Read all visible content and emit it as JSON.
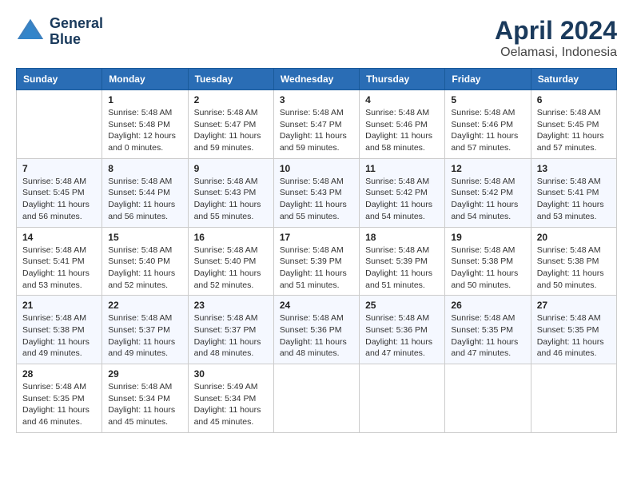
{
  "header": {
    "logo_line1": "General",
    "logo_line2": "Blue",
    "month_year": "April 2024",
    "location": "Oelamasi, Indonesia"
  },
  "weekdays": [
    "Sunday",
    "Monday",
    "Tuesday",
    "Wednesday",
    "Thursday",
    "Friday",
    "Saturday"
  ],
  "weeks": [
    [
      {
        "day": "",
        "sunrise": "",
        "sunset": "",
        "daylight": ""
      },
      {
        "day": "1",
        "sunrise": "Sunrise: 5:48 AM",
        "sunset": "Sunset: 5:48 PM",
        "daylight": "Daylight: 12 hours and 0 minutes."
      },
      {
        "day": "2",
        "sunrise": "Sunrise: 5:48 AM",
        "sunset": "Sunset: 5:47 PM",
        "daylight": "Daylight: 11 hours and 59 minutes."
      },
      {
        "day": "3",
        "sunrise": "Sunrise: 5:48 AM",
        "sunset": "Sunset: 5:47 PM",
        "daylight": "Daylight: 11 hours and 59 minutes."
      },
      {
        "day": "4",
        "sunrise": "Sunrise: 5:48 AM",
        "sunset": "Sunset: 5:46 PM",
        "daylight": "Daylight: 11 hours and 58 minutes."
      },
      {
        "day": "5",
        "sunrise": "Sunrise: 5:48 AM",
        "sunset": "Sunset: 5:46 PM",
        "daylight": "Daylight: 11 hours and 57 minutes."
      },
      {
        "day": "6",
        "sunrise": "Sunrise: 5:48 AM",
        "sunset": "Sunset: 5:45 PM",
        "daylight": "Daylight: 11 hours and 57 minutes."
      }
    ],
    [
      {
        "day": "7",
        "sunrise": "Sunrise: 5:48 AM",
        "sunset": "Sunset: 5:45 PM",
        "daylight": "Daylight: 11 hours and 56 minutes."
      },
      {
        "day": "8",
        "sunrise": "Sunrise: 5:48 AM",
        "sunset": "Sunset: 5:44 PM",
        "daylight": "Daylight: 11 hours and 56 minutes."
      },
      {
        "day": "9",
        "sunrise": "Sunrise: 5:48 AM",
        "sunset": "Sunset: 5:43 PM",
        "daylight": "Daylight: 11 hours and 55 minutes."
      },
      {
        "day": "10",
        "sunrise": "Sunrise: 5:48 AM",
        "sunset": "Sunset: 5:43 PM",
        "daylight": "Daylight: 11 hours and 55 minutes."
      },
      {
        "day": "11",
        "sunrise": "Sunrise: 5:48 AM",
        "sunset": "Sunset: 5:42 PM",
        "daylight": "Daylight: 11 hours and 54 minutes."
      },
      {
        "day": "12",
        "sunrise": "Sunrise: 5:48 AM",
        "sunset": "Sunset: 5:42 PM",
        "daylight": "Daylight: 11 hours and 54 minutes."
      },
      {
        "day": "13",
        "sunrise": "Sunrise: 5:48 AM",
        "sunset": "Sunset: 5:41 PM",
        "daylight": "Daylight: 11 hours and 53 minutes."
      }
    ],
    [
      {
        "day": "14",
        "sunrise": "Sunrise: 5:48 AM",
        "sunset": "Sunset: 5:41 PM",
        "daylight": "Daylight: 11 hours and 53 minutes."
      },
      {
        "day": "15",
        "sunrise": "Sunrise: 5:48 AM",
        "sunset": "Sunset: 5:40 PM",
        "daylight": "Daylight: 11 hours and 52 minutes."
      },
      {
        "day": "16",
        "sunrise": "Sunrise: 5:48 AM",
        "sunset": "Sunset: 5:40 PM",
        "daylight": "Daylight: 11 hours and 52 minutes."
      },
      {
        "day": "17",
        "sunrise": "Sunrise: 5:48 AM",
        "sunset": "Sunset: 5:39 PM",
        "daylight": "Daylight: 11 hours and 51 minutes."
      },
      {
        "day": "18",
        "sunrise": "Sunrise: 5:48 AM",
        "sunset": "Sunset: 5:39 PM",
        "daylight": "Daylight: 11 hours and 51 minutes."
      },
      {
        "day": "19",
        "sunrise": "Sunrise: 5:48 AM",
        "sunset": "Sunset: 5:38 PM",
        "daylight": "Daylight: 11 hours and 50 minutes."
      },
      {
        "day": "20",
        "sunrise": "Sunrise: 5:48 AM",
        "sunset": "Sunset: 5:38 PM",
        "daylight": "Daylight: 11 hours and 50 minutes."
      }
    ],
    [
      {
        "day": "21",
        "sunrise": "Sunrise: 5:48 AM",
        "sunset": "Sunset: 5:38 PM",
        "daylight": "Daylight: 11 hours and 49 minutes."
      },
      {
        "day": "22",
        "sunrise": "Sunrise: 5:48 AM",
        "sunset": "Sunset: 5:37 PM",
        "daylight": "Daylight: 11 hours and 49 minutes."
      },
      {
        "day": "23",
        "sunrise": "Sunrise: 5:48 AM",
        "sunset": "Sunset: 5:37 PM",
        "daylight": "Daylight: 11 hours and 48 minutes."
      },
      {
        "day": "24",
        "sunrise": "Sunrise: 5:48 AM",
        "sunset": "Sunset: 5:36 PM",
        "daylight": "Daylight: 11 hours and 48 minutes."
      },
      {
        "day": "25",
        "sunrise": "Sunrise: 5:48 AM",
        "sunset": "Sunset: 5:36 PM",
        "daylight": "Daylight: 11 hours and 47 minutes."
      },
      {
        "day": "26",
        "sunrise": "Sunrise: 5:48 AM",
        "sunset": "Sunset: 5:35 PM",
        "daylight": "Daylight: 11 hours and 47 minutes."
      },
      {
        "day": "27",
        "sunrise": "Sunrise: 5:48 AM",
        "sunset": "Sunset: 5:35 PM",
        "daylight": "Daylight: 11 hours and 46 minutes."
      }
    ],
    [
      {
        "day": "28",
        "sunrise": "Sunrise: 5:48 AM",
        "sunset": "Sunset: 5:35 PM",
        "daylight": "Daylight: 11 hours and 46 minutes."
      },
      {
        "day": "29",
        "sunrise": "Sunrise: 5:48 AM",
        "sunset": "Sunset: 5:34 PM",
        "daylight": "Daylight: 11 hours and 45 minutes."
      },
      {
        "day": "30",
        "sunrise": "Sunrise: 5:49 AM",
        "sunset": "Sunset: 5:34 PM",
        "daylight": "Daylight: 11 hours and 45 minutes."
      },
      {
        "day": "",
        "sunrise": "",
        "sunset": "",
        "daylight": ""
      },
      {
        "day": "",
        "sunrise": "",
        "sunset": "",
        "daylight": ""
      },
      {
        "day": "",
        "sunrise": "",
        "sunset": "",
        "daylight": ""
      },
      {
        "day": "",
        "sunrise": "",
        "sunset": "",
        "daylight": ""
      }
    ]
  ]
}
